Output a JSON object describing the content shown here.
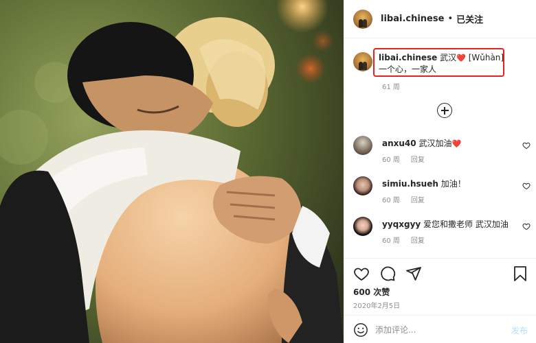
{
  "post": {
    "username": "libai.chinese",
    "separator": "•",
    "follow_status": "已关注"
  },
  "caption": {
    "username": "libai.chinese",
    "text_before_heart": "武汉",
    "heart": "❤️",
    "text_after_heart": " [Wǔhàn]",
    "line2": "一个心，一家人",
    "time": "61 周",
    "highlight_color": "#e8201f"
  },
  "comments": [
    {
      "username": "anxu40",
      "text": "武汉加油",
      "heart": "❤️",
      "time": "60 周",
      "reply": "回复"
    },
    {
      "username": "simiu.hsueh",
      "text": "加油！",
      "heart": "",
      "time": "60 周",
      "reply": "回复"
    },
    {
      "username": "yyqxgyy",
      "text": "爱您和撒老师 武汉加油",
      "heart": "",
      "time": "60 周",
      "reply": "回复"
    }
  ],
  "actions": {
    "likes": "600 次赞",
    "date": "2020年2月5日"
  },
  "add_comment": {
    "placeholder": "添加评论...",
    "post_label": "发布"
  },
  "icons": {
    "load_more": "plus-circle-icon",
    "like": "heart-outline-icon",
    "comment": "comment-bubble-icon",
    "share": "paper-plane-icon",
    "save": "bookmark-icon",
    "emoji": "emoji-icon"
  },
  "colors": {
    "text": "#262626",
    "muted": "#8e8e8e",
    "heart": "#e0212d",
    "post_button": "#b2dffc"
  }
}
